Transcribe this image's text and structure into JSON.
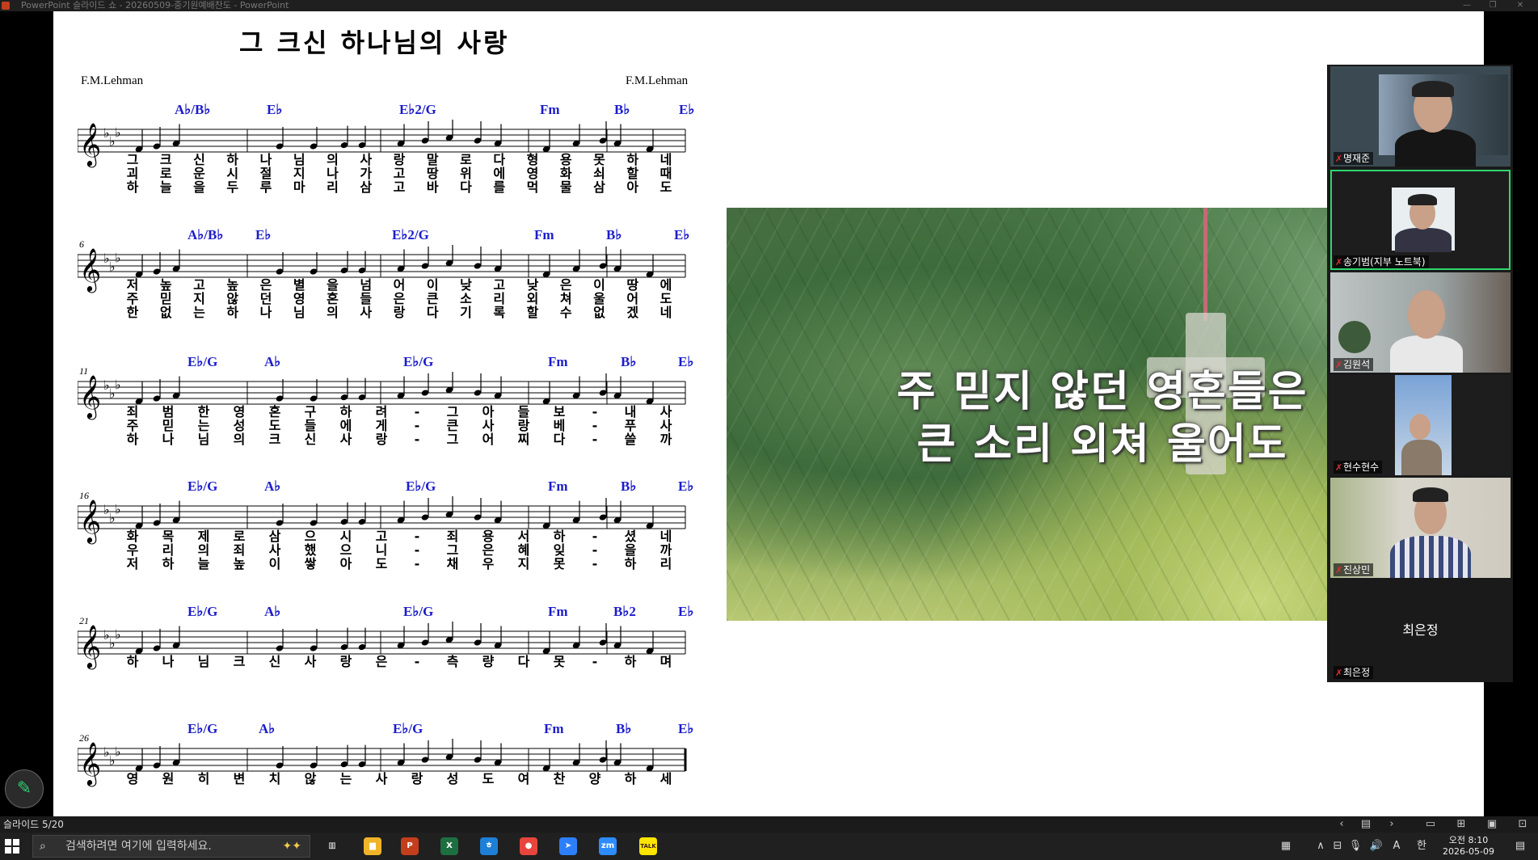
{
  "titlebar": {
    "title": "PowerPoint 슬라이드 쇼  -  20260509-중기원예배찬도 - PowerPoint",
    "buttons": [
      "—",
      "❐",
      "✕"
    ]
  },
  "slide": {
    "song_title": "그 크신 하나님의 사랑",
    "composer_left": "F.M.Lehman",
    "composer_right": "F.M.Lehman",
    "systems": [
      {
        "measure": "",
        "chords": [
          "A♭/B♭",
          "E♭",
          "E♭2/G",
          "Fm",
          "B♭",
          "E♭"
        ],
        "lyrics": [
          [
            "그",
            "크",
            "신",
            "하",
            "나",
            "님",
            "의",
            "사",
            "랑",
            "말",
            "로",
            "다",
            "형",
            "용",
            "못",
            "하",
            "네"
          ],
          [
            "괴",
            "로",
            "운",
            "시",
            "절",
            "지",
            "나",
            "가",
            "고",
            "땅",
            "위",
            "에",
            "영",
            "화",
            "쇠",
            "할",
            "때"
          ],
          [
            "하",
            "늘",
            "을",
            "두",
            "루",
            "마",
            "리",
            "삼",
            "고",
            "바",
            "다",
            "를",
            "먹",
            "물",
            "삼",
            "아",
            "도"
          ]
        ]
      },
      {
        "measure": "6",
        "chords": [
          "A♭/B♭",
          "E♭",
          "E♭2/G",
          "Fm",
          "B♭",
          "E♭"
        ],
        "lyrics": [
          [
            "저",
            "높",
            "고",
            "높",
            "은",
            "별",
            "을",
            "넘",
            "어",
            "이",
            "낮",
            "고",
            "낮",
            "은",
            "이",
            "땅",
            "에"
          ],
          [
            "주",
            "믿",
            "지",
            "않",
            "던",
            "영",
            "혼",
            "들",
            "은",
            "큰",
            "소",
            "리",
            "외",
            "쳐",
            "울",
            "어",
            "도"
          ],
          [
            "한",
            "없",
            "는",
            "하",
            "나",
            "님",
            "의",
            "사",
            "랑",
            "다",
            "기",
            "록",
            "할",
            "수",
            "없",
            "겠",
            "네"
          ]
        ]
      },
      {
        "measure": "11",
        "chords": [
          "E♭/G",
          "A♭",
          "E♭/G",
          "Fm",
          "B♭",
          "E♭"
        ],
        "lyrics": [
          [
            "죄",
            "범",
            "한",
            "영",
            "혼",
            "구",
            "하",
            "려",
            "-",
            "그",
            "아",
            "들",
            "보",
            "-",
            "내",
            "사"
          ],
          [
            "주",
            "믿",
            "는",
            "성",
            "도",
            "들",
            "에",
            "게",
            "-",
            "큰",
            "사",
            "랑",
            "베",
            "-",
            "푸",
            "사"
          ],
          [
            "하",
            "나",
            "님",
            "의",
            "크",
            "신",
            "사",
            "랑",
            "-",
            "그",
            "어",
            "찌",
            "다",
            "-",
            "쓸",
            "까"
          ]
        ]
      },
      {
        "measure": "16",
        "chords": [
          "E♭/G",
          "A♭",
          "E♭/G",
          "Fm",
          "B♭",
          "E♭"
        ],
        "lyrics": [
          [
            "화",
            "목",
            "제",
            "로",
            "삼",
            "으",
            "시",
            "고",
            "-",
            "죄",
            "용",
            "서",
            "하",
            "-",
            "셨",
            "네"
          ],
          [
            "우",
            "리",
            "의",
            "죄",
            "사",
            "했",
            "으",
            "니",
            "-",
            "그",
            "은",
            "혜",
            "잊",
            "-",
            "을",
            "까"
          ],
          [
            "저",
            "하",
            "늘",
            "높",
            "이",
            "쌓",
            "아",
            "도",
            "-",
            "채",
            "우",
            "지",
            "못",
            "-",
            "하",
            "리"
          ]
        ]
      },
      {
        "measure": "21",
        "chords": [
          "E♭/G",
          "A♭",
          "E♭/G",
          "Fm",
          "B♭2",
          "E♭"
        ],
        "lyrics": [
          [
            "하",
            "나",
            "님",
            "크",
            "신",
            "사",
            "랑",
            "은",
            "-",
            "측",
            "량",
            "다",
            "못",
            "-",
            "하",
            "며"
          ]
        ]
      },
      {
        "measure": "26",
        "chords": [
          "E♭/G",
          "A♭",
          "E♭/G",
          "Fm",
          "B♭",
          "E♭"
        ],
        "lyrics": [
          [
            "영",
            "원",
            "히",
            "변",
            "치",
            "않",
            "는",
            "사",
            "랑",
            "성",
            "도",
            "여",
            "찬",
            "양",
            "하",
            "세"
          ]
        ]
      }
    ],
    "video_caption": [
      "주 믿지 않던 영혼들은",
      "큰 소리 외쳐 울어도"
    ]
  },
  "gallery": {
    "participants": [
      {
        "name": "명재준",
        "active": false
      },
      {
        "name": "송기범(지부 노트북)",
        "active": true
      },
      {
        "name": "김원석",
        "active": false
      },
      {
        "name": "현수현수",
        "active": false
      },
      {
        "name": "진상민",
        "active": false
      },
      {
        "name": "최은정",
        "active": false,
        "video_off": true
      }
    ]
  },
  "statusbar": {
    "slide_indicator": "슬라이드 5/20",
    "controls": [
      "‹",
      "▤",
      "›",
      "▭",
      "⊞",
      "▣",
      "⊡"
    ]
  },
  "taskbar": {
    "search_placeholder": "검색하려면 여기에 입력하세요.",
    "apps": [
      {
        "name": "task-view",
        "glyph": "▥",
        "color": "#202020"
      },
      {
        "name": "file-explorer",
        "glyph": "▆",
        "color": "#f0b429"
      },
      {
        "name": "powerpoint",
        "glyph": "P",
        "color": "#c43e1c"
      },
      {
        "name": "excel",
        "glyph": "X",
        "color": "#1d6f42"
      },
      {
        "name": "hangul",
        "glyph": "ㅎ",
        "color": "#1e7fd6"
      },
      {
        "name": "chrome",
        "glyph": "●",
        "color": "#e8453c"
      },
      {
        "name": "arrow-app",
        "glyph": "➤",
        "color": "#2d7ff9"
      },
      {
        "name": "zoom",
        "glyph": "zm",
        "color": "#2d8cff"
      },
      {
        "name": "kakaotalk",
        "glyph": "TALK",
        "color": "#fee500"
      }
    ],
    "tray": [
      "▦",
      "∧",
      "⊟",
      "🎙",
      "🔊",
      "A",
      "한"
    ],
    "clock_time": "오전 8:10",
    "clock_date": "2026-05-09",
    "notification": "▤"
  }
}
